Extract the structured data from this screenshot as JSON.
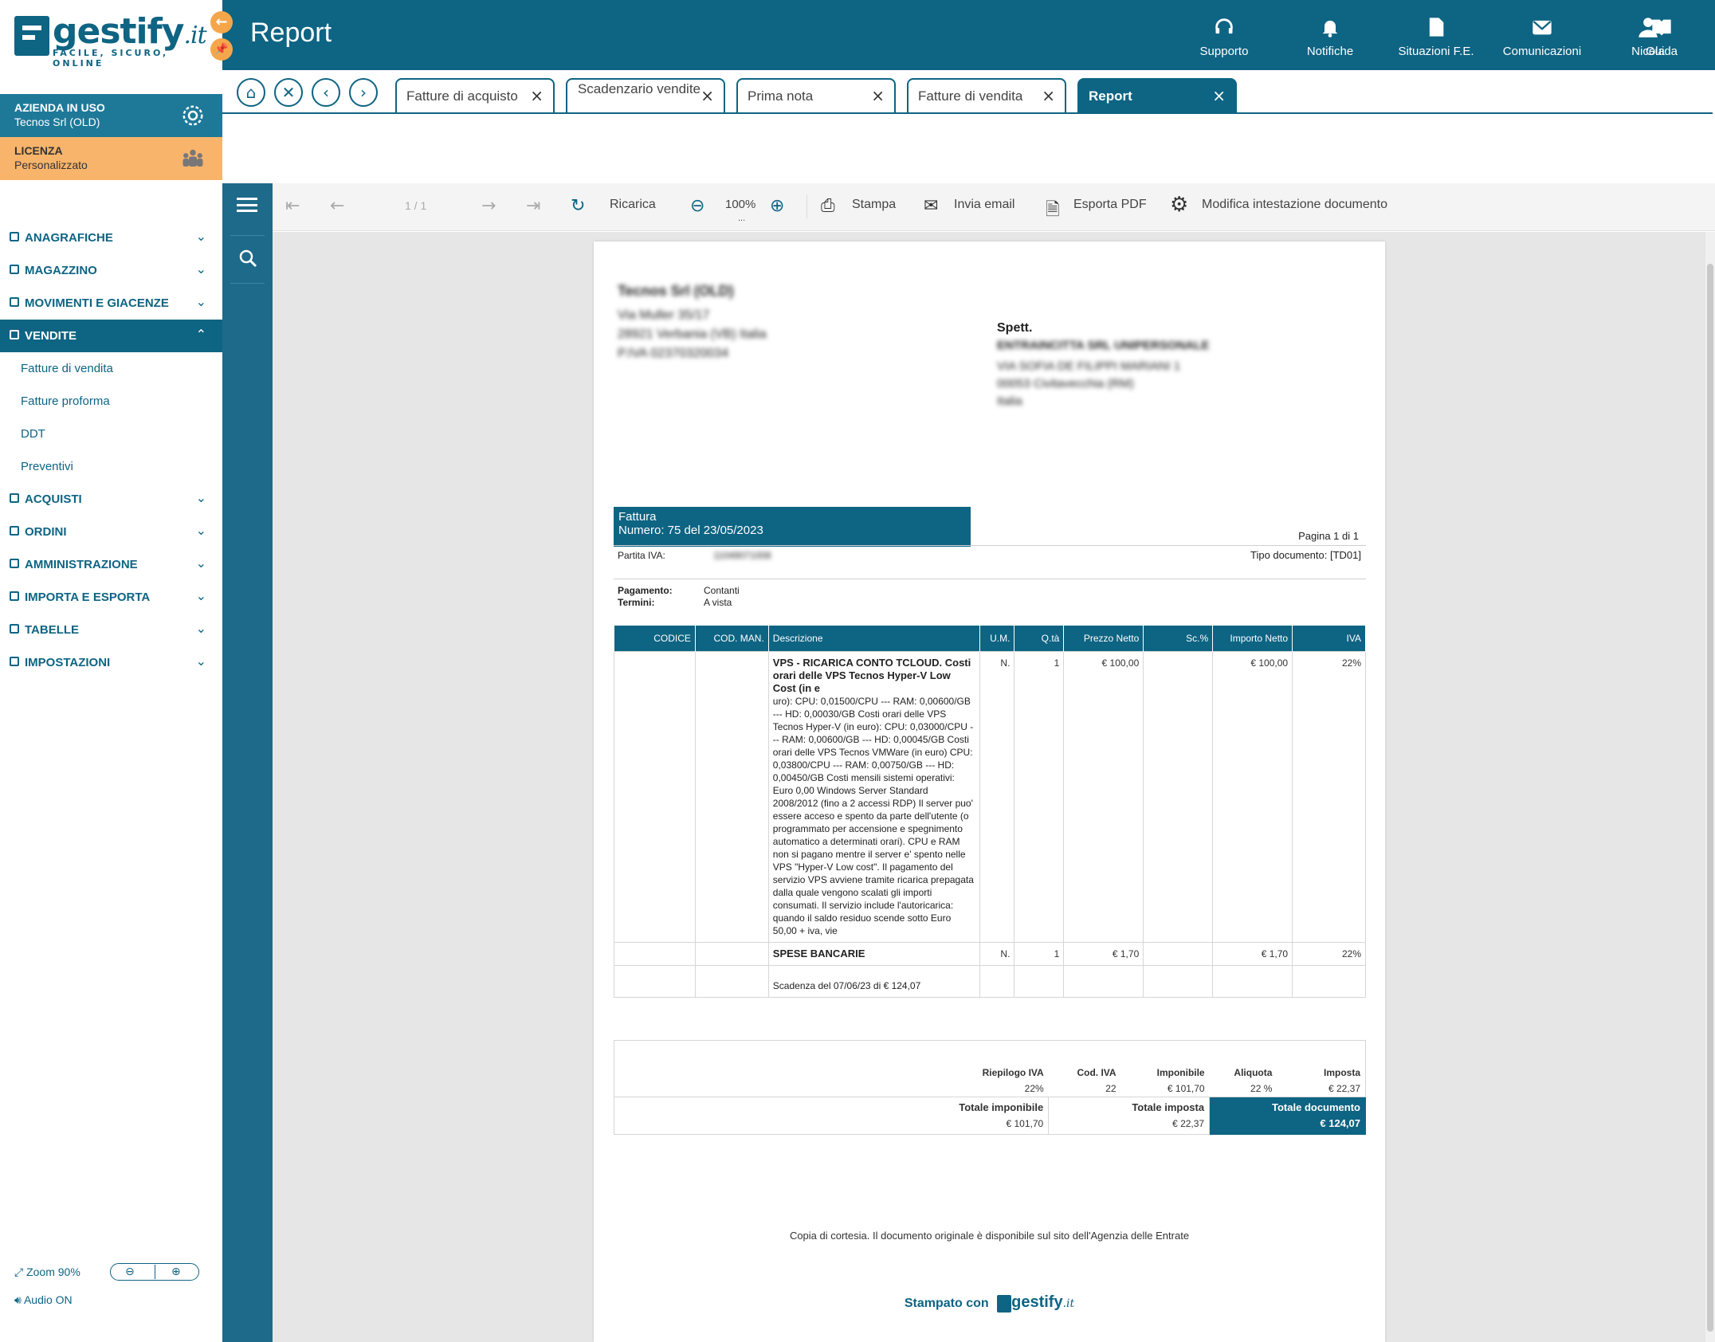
{
  "app": {
    "brand": "gestify",
    "brand_suffix": ".it",
    "tagline": "FACILE, SICURO, ONLINE",
    "page_title": "Report"
  },
  "topnav": [
    {
      "label": "Supporto",
      "icon": "headset-icon"
    },
    {
      "label": "Notifiche",
      "icon": "bell-icon"
    },
    {
      "label": "Situazioni F.E.",
      "icon": "document-icon"
    },
    {
      "label": "Comunicazioni",
      "icon": "mail-icon"
    },
    {
      "label": "Nicola",
      "icon": "user-icon"
    },
    {
      "label": "Guida",
      "icon": "book-icon"
    }
  ],
  "tabs": [
    {
      "label": "Fatture di acquisto"
    },
    {
      "label": "Scadenzario vendite"
    },
    {
      "label": "Prima nota"
    },
    {
      "label": "Fatture di vendita"
    },
    {
      "label": "Report",
      "active": true
    }
  ],
  "company": {
    "title": "AZIENDA IN USO",
    "name": "Tecnos Srl (OLD)"
  },
  "license": {
    "title": "LICENZA",
    "name": "Personalizzato"
  },
  "menu": {
    "anagrafiche": "ANAGRAFICHE",
    "magazzino": "MAGAZZINO",
    "movimenti": "MOVIMENTI E GIACENZE",
    "vendite": "VENDITE",
    "vendite_sub": [
      "Fatture di vendita",
      "Fatture proforma",
      "DDT",
      "Preventivi"
    ],
    "acquisti": "ACQUISTI",
    "ordini": "ORDINI",
    "amministrazione": "AMMINISTRAZIONE",
    "importa": "IMPORTA E ESPORTA",
    "tabelle": "TABELLE",
    "impostazioni": "IMPOSTAZIONI"
  },
  "footer": {
    "zoom": "Zoom 90%",
    "audio": "Audio ON"
  },
  "toolbar": {
    "pages": "1 / 1",
    "reload": "Ricarica",
    "zoom": "100%",
    "zoom_more": "...",
    "print": "Stampa",
    "email": "Invia email",
    "pdf": "Esporta PDF",
    "header": "Modifica intestazione documento"
  },
  "invoice": {
    "sender": {
      "name": "Tecnos Srl (OLD)",
      "address": "Via Muller 35/17",
      "city": "28921 Verbania (VB) Italia",
      "vat": "P.IVA 02370320034"
    },
    "recipient": {
      "title": "Spett.",
      "name": "ENTRAINCITTA SRL UNIPERSONALE",
      "address": "VIA SOFIA DE FILIPPI MARIANI 1",
      "city": "00053 Civitavecchia (RM)",
      "country": "Italia"
    },
    "doc_type": "Fattura",
    "doc_number": "Numero: 75 del 23/05/2023",
    "page": "Pagina 1 di 1",
    "vat_label": "Partita IVA:",
    "vat_value": "11049071008",
    "tipo_doc": "Tipo documento: [TD01]",
    "pay_label": "Pagamento:",
    "pay_value": "Contanti",
    "terms_label": "Termini:",
    "terms_value": "A vista",
    "columns": [
      "CODICE",
      "COD. MAN.",
      "Descrizione",
      "U.M.",
      "Q.tà",
      "Prezzo Netto",
      "Sc.%",
      "Importo Netto",
      "IVA"
    ],
    "item1_title": "VPS - RICARICA CONTO TCLOUD. Costi orari delle VPS Tecnos Hyper-V Low Cost (in e",
    "item1_text": "uro): CPU: 0,01500/CPU --- RAM: 0,00600/GB --- HD: 0,00030/GB Costi orari delle VPS Tecnos Hyper-V (in euro): CPU: 0,03000/CPU --- RAM: 0,00600/GB --- HD: 0,00045/GB Costi orari delle VPS Tecnos VMWare (in euro) CPU: 0,03800/CPU --- RAM: 0,00750/GB --- HD: 0,00450/GB Costi mensili sistemi operativi: Euro 0,00 Windows Server Standard 2008/2012 (fino a 2 accessi RDP) Il server puo' essere acceso e spento da parte dell'utente (o programmato per accensione e spegnimento automatico a determinati orari). CPU e RAM non si pagano mentre il server e' spento nelle VPS \"Hyper-V Low cost\". Il pagamento del servizio VPS avviene tramite ricarica prepagata dalla quale vengono scalati gli importi consumati. Il servizio include l'autoricarica: quando il saldo residuo scende sotto Euro 50,00 + iva, vie",
    "item1_um": "N.",
    "item1_qty": "1",
    "item1_price": "€ 100,00",
    "item1_amount": "€ 100,00",
    "item1_iva": "22%",
    "item2_title": "SPESE BANCARIE",
    "item2_um": "N.",
    "item2_qty": "1",
    "item2_price": "€ 1,70",
    "item2_amount": "€ 1,70",
    "item2_iva": "22%",
    "due": "Scadenza del 07/06/23 di € 124,07",
    "riep_headers": [
      "Riepilogo IVA",
      "Cod. IVA",
      "Imponibile",
      "Aliquota",
      "Imposta"
    ],
    "riep_values": [
      "22%",
      "22",
      "€ 101,70",
      "22 %",
      "€ 22,37"
    ],
    "tot_imponibile_label": "Totale imponibile",
    "tot_imponibile": "€ 101,70",
    "tot_imposta_label": "Totale imposta",
    "tot_imposta": "€ 22,37",
    "tot_doc_label": "Totale documento",
    "tot_doc": "€ 124,07",
    "note": "Copia di cortesia. Il documento originale è disponibile sul sito dell'Agenzia delle Entrate",
    "stamp": "Stampato con"
  },
  "colors": {
    "primary": "#0e6483",
    "accent": "#f5a64a",
    "license_bg": "#f8b46a"
  }
}
